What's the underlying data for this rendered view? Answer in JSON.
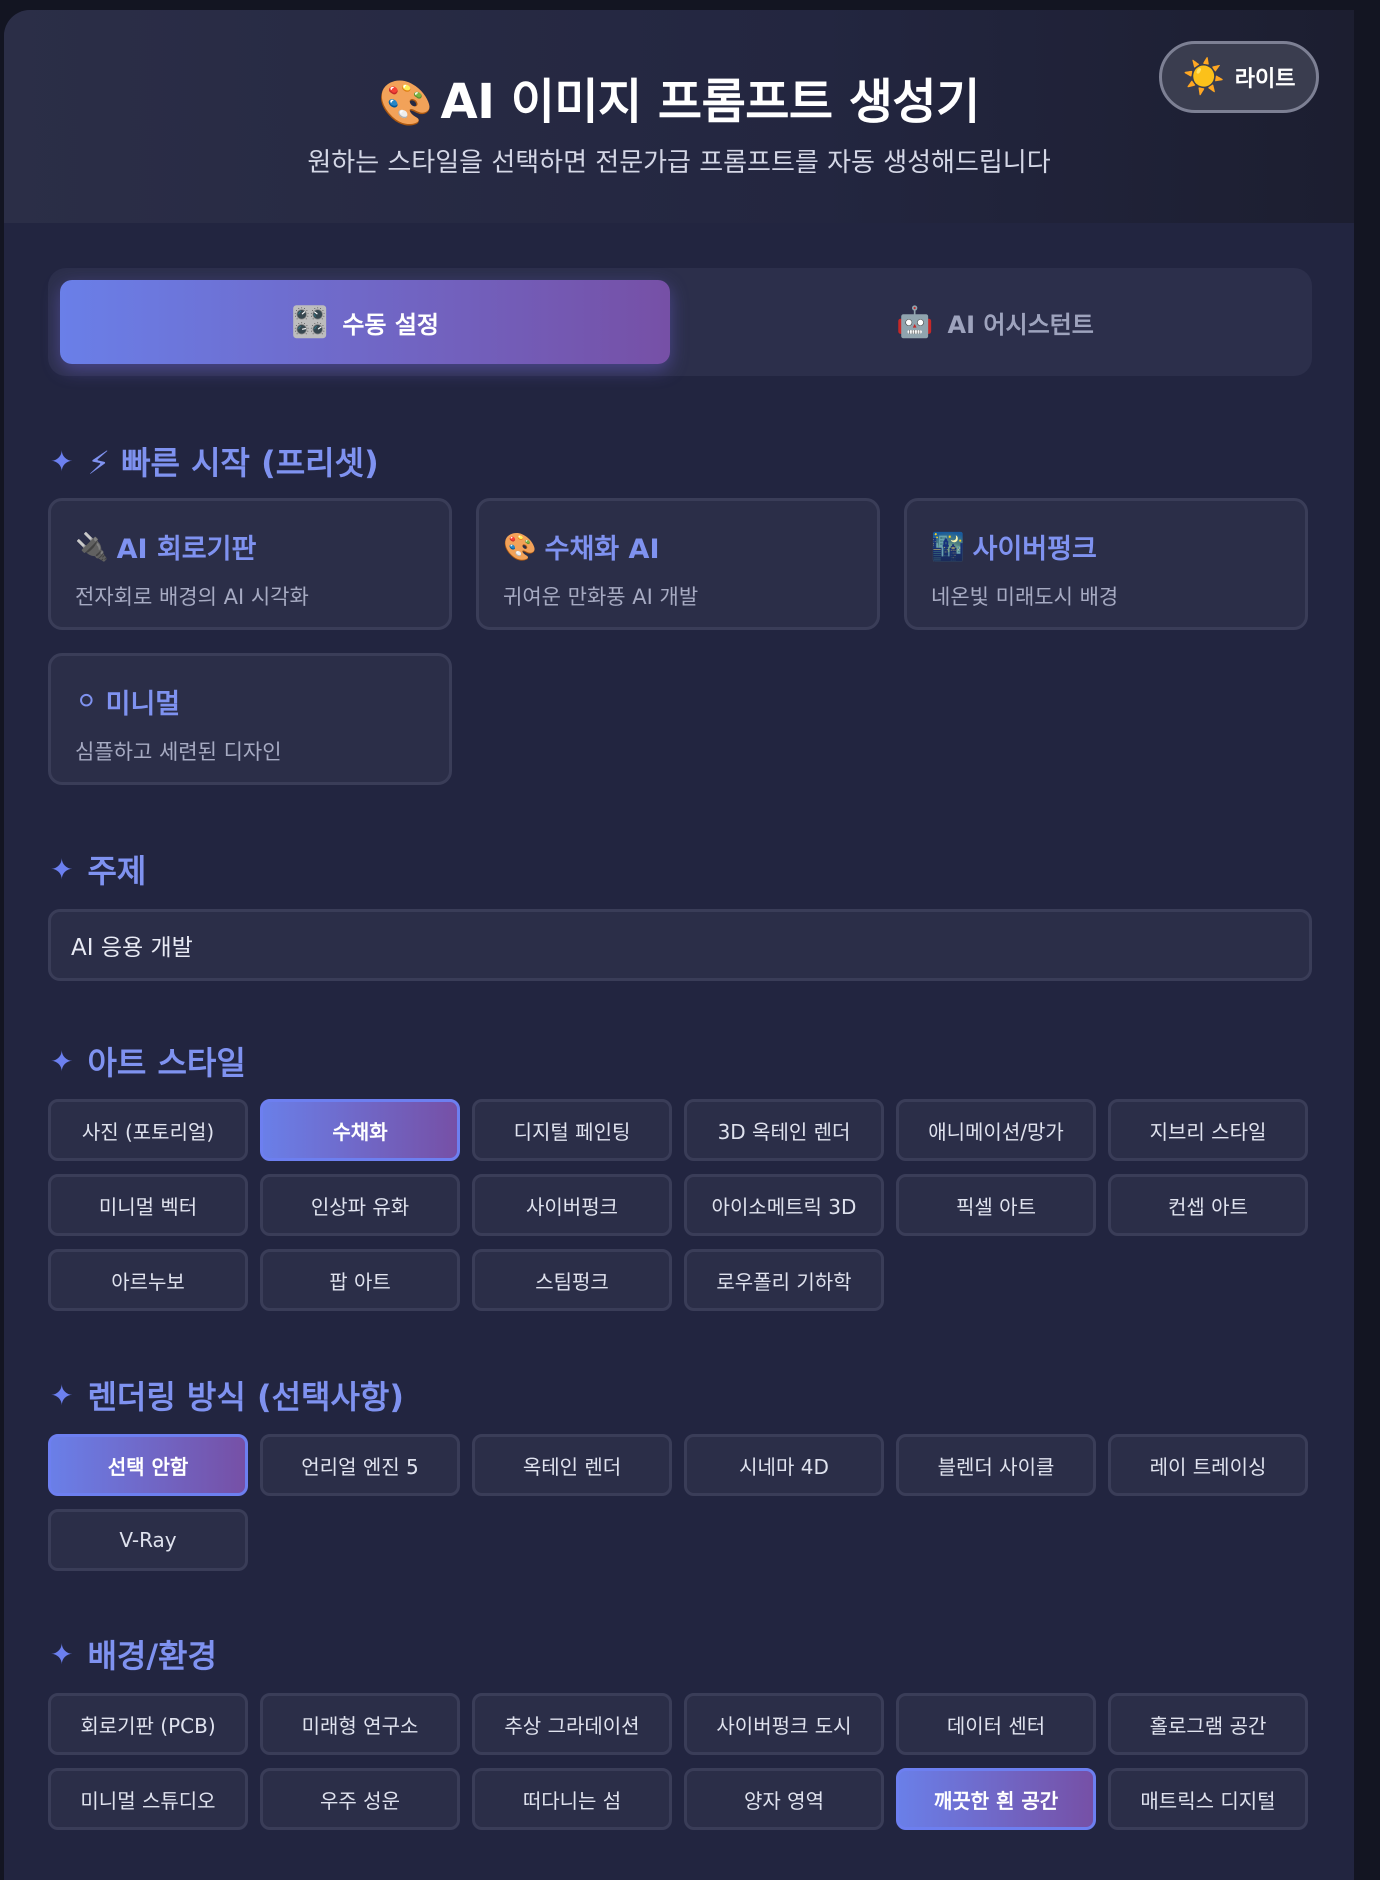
{
  "header": {
    "title_emoji": "🎨",
    "title": "AI 이미지 프롬프트 생성기",
    "subtitle": "원하는 스타일을 선택하면 전문가급 프롬프트를 자동 생성해드립니다",
    "theme_toggle": {
      "icon": "☀️",
      "label": "라이트"
    }
  },
  "mode_tabs": [
    {
      "icon": "🎛️",
      "label": "수동 설정",
      "active": true
    },
    {
      "icon": "🤖",
      "label": "AI 어시스턴트",
      "active": false
    }
  ],
  "presets_section": {
    "title": "⚡ 빠른 시작 (프리셋)",
    "items": [
      {
        "icon": "🔌",
        "title": "AI 회로기판",
        "desc": "전자회로 배경의 AI 시각화"
      },
      {
        "icon": "🎨",
        "title": "수채화 AI",
        "desc": "귀여운 만화풍 AI 개발"
      },
      {
        "icon": "🌃",
        "title": "사이버펑크",
        "desc": "네온빛 미래도시 배경"
      },
      {
        "icon": "⚪",
        "title": "미니멀",
        "desc": "심플하고 세련된 디자인"
      }
    ]
  },
  "topic_section": {
    "title": "주제",
    "value": "AI 응용 개발"
  },
  "art_style_section": {
    "title": "아트 스타일",
    "options": [
      "사진 (포토리얼)",
      "수채화",
      "디지털 페인팅",
      "3D 옥테인 렌더",
      "애니메이션/망가",
      "지브리 스타일",
      "미니멀 벡터",
      "인상파 유화",
      "사이버펑크",
      "아이소메트릭 3D",
      "픽셀 아트",
      "컨셉 아트",
      "아르누보",
      "팝 아트",
      "스팀펑크",
      "로우폴리 기하학"
    ],
    "selected": "수채화"
  },
  "render_section": {
    "title": "렌더링 방식 (선택사항)",
    "options": [
      "선택 안함",
      "언리얼 엔진 5",
      "옥테인 렌더",
      "시네마 4D",
      "블렌더 사이클",
      "레이 트레이싱",
      "V-Ray"
    ],
    "selected": "선택 안함"
  },
  "background_section": {
    "title": "배경/환경",
    "options": [
      "회로기판 (PCB)",
      "미래형 연구소",
      "추상 그라데이션",
      "사이버펑크 도시",
      "데이터 센터",
      "홀로그램 공간",
      "미니멀 스튜디오",
      "우주 성운",
      "떠다니는 섬",
      "양자 영역",
      "깨끗한 흰 공간",
      "매트릭스 디지털"
    ],
    "selected": "깨끗한 흰 공간"
  },
  "section_marker": "✦",
  "colors": {
    "accent": "#7f92f0",
    "gradient_start": "#6a7fe8",
    "gradient_end": "#7650a6",
    "panel": "#222540",
    "card": "#2b2e48"
  }
}
